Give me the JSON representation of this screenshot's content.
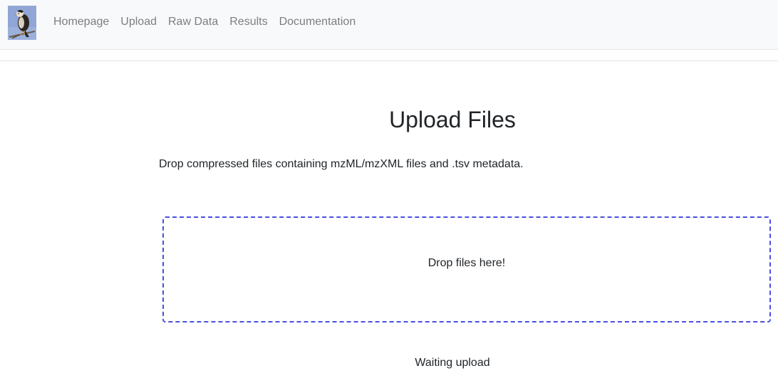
{
  "nav": {
    "logo_icon": "bird-logo-icon",
    "links": [
      {
        "label": "Homepage"
      },
      {
        "label": "Upload"
      },
      {
        "label": "Raw Data"
      },
      {
        "label": "Results"
      },
      {
        "label": "Documentation"
      }
    ]
  },
  "main": {
    "title": "Upload Files",
    "description": "Drop compressed files containing mzML/mzXML files and .tsv metadata.",
    "dropzone_label": "Drop files here!",
    "status": "Waiting upload"
  },
  "colors": {
    "navbar_bg": "#f8f9fa",
    "nav_link": "#7b7f83",
    "dropzone_border": "#4a4fe0",
    "text": "#212529"
  }
}
